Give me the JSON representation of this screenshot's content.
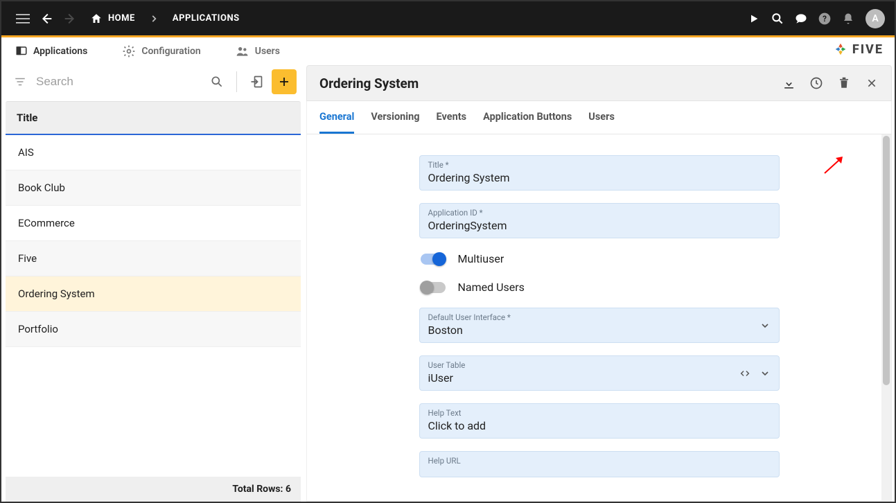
{
  "topbar": {
    "breadcrumb_home": "HOME",
    "breadcrumb_page": "APPLICATIONS",
    "avatar_initial": "A"
  },
  "nav": {
    "tabs": [
      {
        "label": "Applications"
      },
      {
        "label": "Configuration"
      },
      {
        "label": "Users"
      }
    ],
    "brand": "FIVE"
  },
  "left": {
    "search_placeholder": "Search",
    "column_header": "Title",
    "rows": [
      "AIS",
      "Book Club",
      "ECommerce",
      "Five",
      "Ordering System",
      "Portfolio"
    ],
    "selected_index": 4,
    "footer": "Total Rows: 6"
  },
  "detail": {
    "title": "Ordering System",
    "tabs": [
      "General",
      "Versioning",
      "Events",
      "Application Buttons",
      "Users"
    ],
    "active_tab": 0,
    "fields": {
      "title_label": "Title *",
      "title_value": "Ordering System",
      "appid_label": "Application ID *",
      "appid_value": "OrderingSystem",
      "multiuser_label": "Multiuser",
      "multiuser_on": true,
      "namedusers_label": "Named Users",
      "namedusers_on": false,
      "dui_label": "Default User Interface *",
      "dui_value": "Boston",
      "usertable_label": "User Table",
      "usertable_value": "iUser",
      "helptext_label": "Help Text",
      "helptext_value": "Click to add",
      "helpurl_label": "Help URL"
    }
  }
}
